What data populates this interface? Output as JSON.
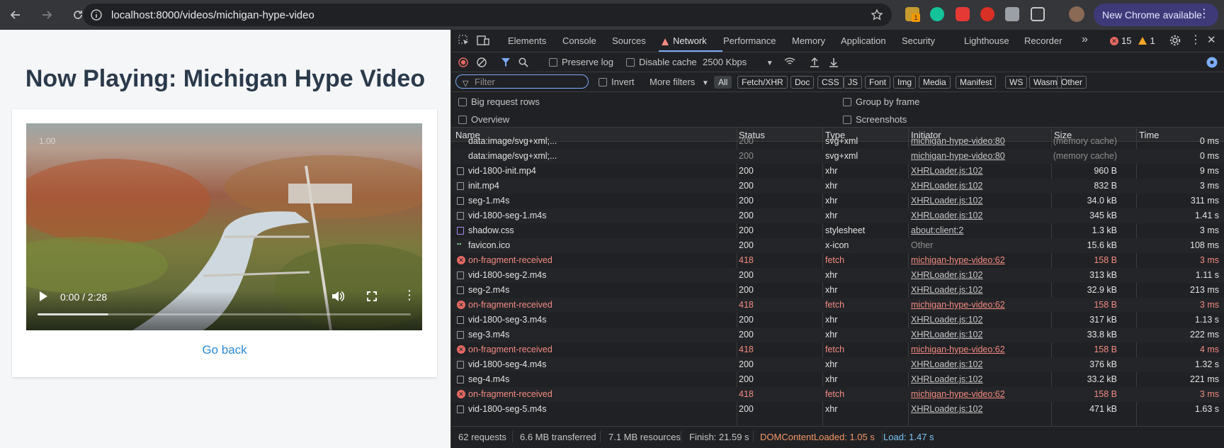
{
  "browser": {
    "url": "localhost:8000/videos/michigan-hype-video",
    "chrome_available_label": "New Chrome available",
    "extension_badge": "1"
  },
  "page": {
    "title": "Now Playing: Michigan Hype Video",
    "video": {
      "speed_overlay": "1.00",
      "time_display": "0:00 / 2:28",
      "buffered_fraction": 0.19
    },
    "go_back_label": "Go back"
  },
  "devtools": {
    "tabs": [
      "Elements",
      "Console",
      "Sources",
      "Network",
      "Performance",
      "Memory",
      "Application",
      "Security",
      "Lighthouse",
      "Recorder"
    ],
    "more_tabs": "»",
    "error_count": "15",
    "warning_count": "1",
    "toolbar": {
      "preserve_log": "Preserve log",
      "disable_cache": "Disable cache",
      "throttling": "2500 Kbps"
    },
    "filter": {
      "placeholder": "Filter",
      "invert": "Invert",
      "more_filters": "More filters",
      "chips": [
        "All",
        "Fetch/XHR",
        "Doc",
        "CSS",
        "JS",
        "Font",
        "Img",
        "Media",
        "Manifest",
        "WS",
        "Wasm",
        "Other"
      ]
    },
    "options": {
      "big_request_rows": "Big request rows",
      "group_by_frame": "Group by frame",
      "overview": "Overview",
      "screenshots": "Screenshots"
    },
    "columns": {
      "name": "Name",
      "status": "Status",
      "type": "Type",
      "initiator": "Initiator",
      "size": "Size",
      "time": "Time"
    },
    "rows": [
      {
        "name": "data:image/svg+xml;...",
        "status": "200",
        "type": "svg+xml",
        "initiator": "michigan-hype-video:80",
        "size": "(memory cache)",
        "time": "0 ms",
        "kind": "data"
      },
      {
        "name": "data:image/svg+xml;...",
        "status": "200",
        "type": "svg+xml",
        "initiator": "michigan-hype-video:80",
        "size": "(memory cache)",
        "time": "0 ms",
        "kind": "data"
      },
      {
        "name": "vid-1800-init.mp4",
        "status": "200",
        "type": "xhr",
        "initiator": "XHRLoader.js:102",
        "size": "960 B",
        "time": "9 ms",
        "kind": "doc"
      },
      {
        "name": "init.mp4",
        "status": "200",
        "type": "xhr",
        "initiator": "XHRLoader.js:102",
        "size": "832 B",
        "time": "3 ms",
        "kind": "doc"
      },
      {
        "name": "seg-1.m4s",
        "status": "200",
        "type": "xhr",
        "initiator": "XHRLoader.js:102",
        "size": "34.0 kB",
        "time": "311 ms",
        "kind": "doc"
      },
      {
        "name": "vid-1800-seg-1.m4s",
        "status": "200",
        "type": "xhr",
        "initiator": "XHRLoader.js:102",
        "size": "345 kB",
        "time": "1.41 s",
        "kind": "doc"
      },
      {
        "name": "shadow.css",
        "status": "200",
        "type": "stylesheet",
        "initiator": "about:client:2",
        "size": "1.3 kB",
        "time": "3 ms",
        "kind": "css"
      },
      {
        "name": "favicon.ico",
        "status": "200",
        "type": "x-icon",
        "initiator": "Other",
        "size": "15.6 kB",
        "time": "108 ms",
        "kind": "fav"
      },
      {
        "name": "on-fragment-received",
        "status": "418",
        "type": "fetch",
        "initiator": "michigan-hype-video:62",
        "size": "158 B",
        "time": "3 ms",
        "kind": "err"
      },
      {
        "name": "vid-1800-seg-2.m4s",
        "status": "200",
        "type": "xhr",
        "initiator": "XHRLoader.js:102",
        "size": "313 kB",
        "time": "1.11 s",
        "kind": "doc"
      },
      {
        "name": "seg-2.m4s",
        "status": "200",
        "type": "xhr",
        "initiator": "XHRLoader.js:102",
        "size": "32.9 kB",
        "time": "213 ms",
        "kind": "doc"
      },
      {
        "name": "on-fragment-received",
        "status": "418",
        "type": "fetch",
        "initiator": "michigan-hype-video:62",
        "size": "158 B",
        "time": "3 ms",
        "kind": "err"
      },
      {
        "name": "vid-1800-seg-3.m4s",
        "status": "200",
        "type": "xhr",
        "initiator": "XHRLoader.js:102",
        "size": "317 kB",
        "time": "1.13 s",
        "kind": "doc"
      },
      {
        "name": "seg-3.m4s",
        "status": "200",
        "type": "xhr",
        "initiator": "XHRLoader.js:102",
        "size": "33.8 kB",
        "time": "222 ms",
        "kind": "doc"
      },
      {
        "name": "on-fragment-received",
        "status": "418",
        "type": "fetch",
        "initiator": "michigan-hype-video:62",
        "size": "158 B",
        "time": "4 ms",
        "kind": "err"
      },
      {
        "name": "vid-1800-seg-4.m4s",
        "status": "200",
        "type": "xhr",
        "initiator": "XHRLoader.js:102",
        "size": "376 kB",
        "time": "1.32 s",
        "kind": "doc"
      },
      {
        "name": "seg-4.m4s",
        "status": "200",
        "type": "xhr",
        "initiator": "XHRLoader.js:102",
        "size": "33.2 kB",
        "time": "221 ms",
        "kind": "doc"
      },
      {
        "name": "on-fragment-received",
        "status": "418",
        "type": "fetch",
        "initiator": "michigan-hype-video:62",
        "size": "158 B",
        "time": "3 ms",
        "kind": "err"
      },
      {
        "name": "vid-1800-seg-5.m4s",
        "status": "200",
        "type": "xhr",
        "initiator": "XHRLoader.js:102",
        "size": "471 kB",
        "time": "1.63 s",
        "kind": "doc"
      }
    ],
    "summary": {
      "requests": "62 requests",
      "transferred": "6.6 MB transferred",
      "resources": "7.1 MB resources",
      "finish": "Finish: 21.59 s",
      "dom_content_loaded": "DOMContentLoaded: 1.05 s",
      "load": "Load: 1.47 s"
    },
    "colors": {
      "accent": "#7cacf8",
      "error": "#f28b82",
      "dcl": "#f29766",
      "load": "#7cc6f8"
    }
  }
}
